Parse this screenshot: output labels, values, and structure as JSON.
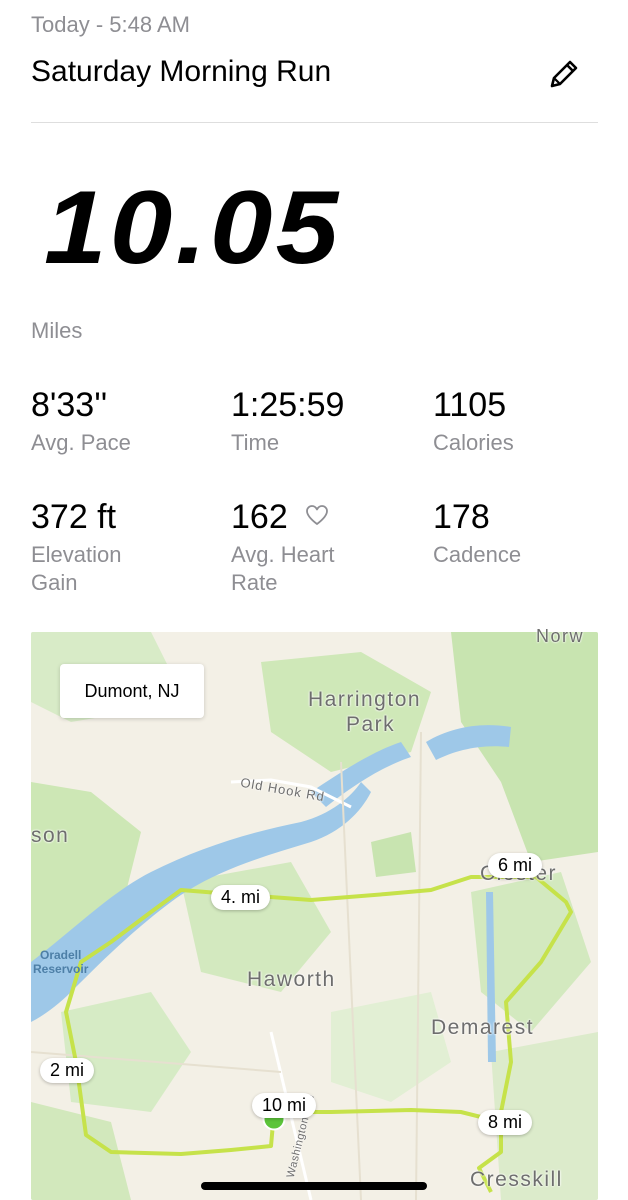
{
  "header": {
    "date": "Today - 5:48 AM",
    "title": "Saturday Morning Run",
    "edit_icon": "pencil-icon"
  },
  "summary": {
    "distance": "10.05",
    "unit": "Miles"
  },
  "stats": [
    {
      "value": "8'33''",
      "label": "Avg. Pace"
    },
    {
      "value": "1:25:59",
      "label": "Time"
    },
    {
      "value": "1105",
      "label": "Calories"
    },
    {
      "value": "372 ft",
      "label_line1": "Elevation",
      "label_line2": "Gain"
    },
    {
      "value": "162",
      "label_line1": "Avg. Heart",
      "label_line2": "Rate",
      "icon": "heart-outline-icon"
    },
    {
      "value": "178",
      "label": "Cadence"
    }
  ],
  "map": {
    "location": "Dumont, NJ",
    "places": [
      "Harrington",
      "Park",
      "Old Hook Rd",
      "son",
      "Oradell",
      "Reservoir",
      "Haworth",
      "Demarest",
      "Closter",
      "Cresskill",
      "Norw",
      "Washington Ave"
    ],
    "mile_markers": [
      "2 mi",
      "4. mi",
      "6 mi",
      "8 mi",
      "10 mi"
    ],
    "colors": {
      "route": "#c6e24a",
      "start": "#5cc43a",
      "end": "#e53935",
      "water": "#9ec8e8",
      "land": "#f3f0e6",
      "park": "#cbe6b4"
    }
  }
}
